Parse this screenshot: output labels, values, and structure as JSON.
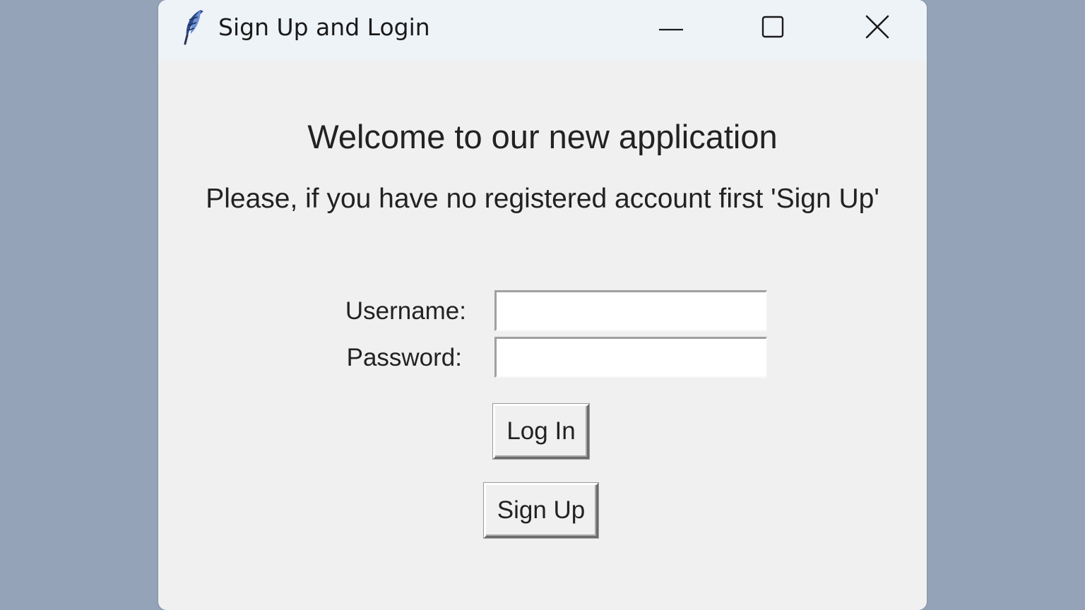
{
  "window": {
    "title": "Sign Up and Login",
    "icon": "feather-icon",
    "controls": [
      "minimize-icon",
      "maximize-icon",
      "close-icon"
    ]
  },
  "content": {
    "welcome": "Welcome to our new application",
    "hint": "Please, if you have no registered account first 'Sign Up'",
    "username_label": "Username:",
    "username_value": "",
    "password_label": "Password:",
    "password_value": "",
    "login_button": "Log In",
    "signup_button": "Sign Up"
  },
  "colors": {
    "desktop": "#94a3b8",
    "window_bg": "#f0f0f0",
    "titlebar_bg": "#eef3f8"
  }
}
